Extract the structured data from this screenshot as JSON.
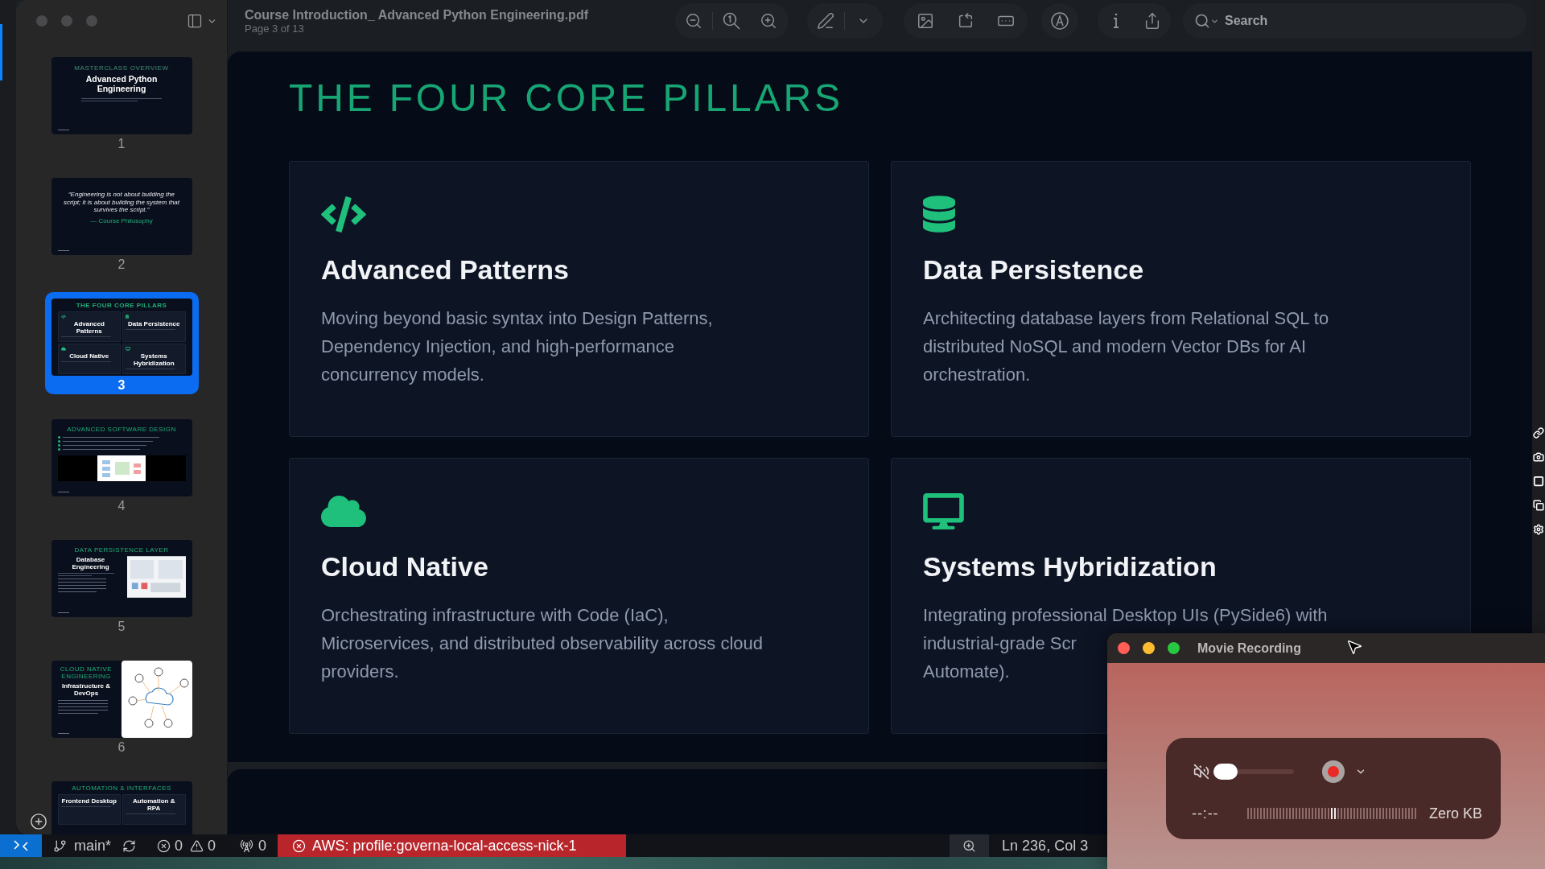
{
  "window": {
    "title": "Course Introduction_ Advanced Python Engineering.pdf",
    "subtitle": "Page 3 of 13"
  },
  "toolbar": {
    "search": {
      "placeholder": "Search"
    }
  },
  "sidebar": {
    "pages": [
      {
        "number": "1",
        "selected": false,
        "kind": "title",
        "eyebrow": "MASTERCLASS OVERVIEW",
        "heading": "Advanced Python Engineering"
      },
      {
        "number": "2",
        "selected": false,
        "kind": "quote",
        "quote": "“Engineering is not about building the script; it is about building the system that survives the script.”",
        "attribution": "— Course Philosophy"
      },
      {
        "number": "3",
        "selected": true,
        "kind": "grid",
        "heading": "THE FOUR CORE PILLARS",
        "items": [
          {
            "kind": "code",
            "title": "Advanced Patterns"
          },
          {
            "kind": "database",
            "title": "Data Persistence"
          },
          {
            "kind": "cloud",
            "title": "Cloud Native"
          },
          {
            "kind": "desktop",
            "title": "Systems Hybridization"
          }
        ]
      },
      {
        "number": "4",
        "selected": false,
        "kind": "bullets_image",
        "heading": "ADVANCED SOFTWARE DESIGN"
      },
      {
        "number": "5",
        "selected": false,
        "kind": "split_image",
        "heading": "DATA PERSISTENCE LAYER",
        "subheading": "Database Engineering"
      },
      {
        "number": "6",
        "selected": false,
        "kind": "half_image",
        "heading": "CLOUD NATIVE ENGINEERING",
        "subheading": "Infrastructure & DevOps"
      },
      {
        "selected": false,
        "kind": "grid",
        "heading": "AUTOMATION & INTERFACES",
        "items": [
          {
            "title": "Frontend Desktop"
          },
          {
            "title": "Automation & RPA"
          }
        ]
      }
    ]
  },
  "slide": {
    "heading": "THE FOUR CORE PILLARS",
    "cards": [
      {
        "kind": "code",
        "title": "Advanced Patterns",
        "description": "Moving beyond basic syntax into Design Patterns,\nDependency Injection, and high-performance\nconcurrency models."
      },
      {
        "kind": "database",
        "title": "Data Persistence",
        "description": "Architecting database layers from Relational SQL to\ndistributed NoSQL and modern Vector DBs for AI\norchestration."
      },
      {
        "kind": "cloud",
        "title": "Cloud Native",
        "description": "Orchestrating infrastructure with Code (IaC),\nMicroservices, and distributed observability across cloud\nproviders."
      },
      {
        "kind": "desktop",
        "title": "Systems Hybridization",
        "description_parts": [
          "Integrating professional Desktop UIs (PySide6) with",
          "industrial-grade Scr",
          "Automate)."
        ]
      }
    ]
  },
  "status_bar": {
    "branch": "main*",
    "errors": "0",
    "warnings": "0",
    "ports": "0",
    "aws_profile": "AWS: profile:governa-local-access-nick-1",
    "cursor_position": "Ln 236, Col 3"
  },
  "recording_window": {
    "title": "Movie Recording",
    "muted": true,
    "volume": {
      "level": 0
    },
    "time": "--:--",
    "file_size": "Zero KB"
  }
}
